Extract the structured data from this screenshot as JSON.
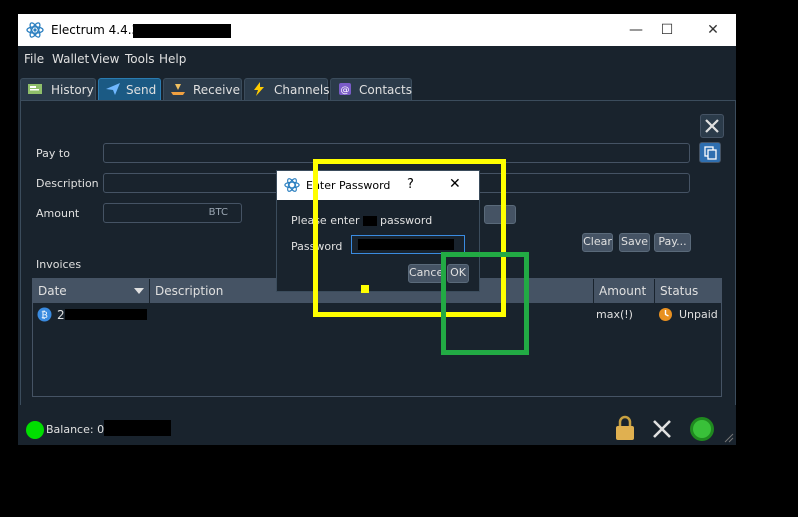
{
  "window": {
    "title": "Electrum 4.4.3  -",
    "minimize_glyph": "—",
    "maximize_glyph": "☐",
    "close_glyph": "✕"
  },
  "menu": [
    "File",
    "Wallet",
    "View",
    "Tools",
    "Help"
  ],
  "tabs": [
    {
      "label": "History",
      "icon": "history-icon"
    },
    {
      "label": "Send",
      "icon": "send-icon",
      "active": true
    },
    {
      "label": "Receive",
      "icon": "receive-icon"
    },
    {
      "label": "Channels",
      "icon": "lightning-icon"
    },
    {
      "label": "Contacts",
      "icon": "contacts-icon"
    }
  ],
  "send": {
    "pay_to_label": "Pay to",
    "description_label": "Description",
    "amount_label": "Amount",
    "amount_unit": "BTC",
    "clear_label": "Clear",
    "save_label": "Save",
    "pay_label": "Pay..."
  },
  "invoices": {
    "title": "Invoices",
    "columns": [
      "Date",
      "Description",
      "Amount",
      "Status"
    ],
    "rows": [
      {
        "date": "2",
        "amount": "max(!)",
        "status": "Unpaid"
      }
    ]
  },
  "status": {
    "balance_label": "Balance: 0.0"
  },
  "dialog": {
    "title": "Enter Password",
    "help_glyph": "?",
    "close_glyph": "✕",
    "message_start": "Please enter y",
    "message_end": "password",
    "password_label": "Password",
    "cancel_label": "Cancel",
    "ok_label": "OK"
  },
  "colors": {
    "window_bg": "#19232d",
    "accent": "#1b5a84",
    "highlight_yellow": "#ffff00",
    "highlight_green": "#22aa44",
    "status_green": "#00dd00"
  }
}
